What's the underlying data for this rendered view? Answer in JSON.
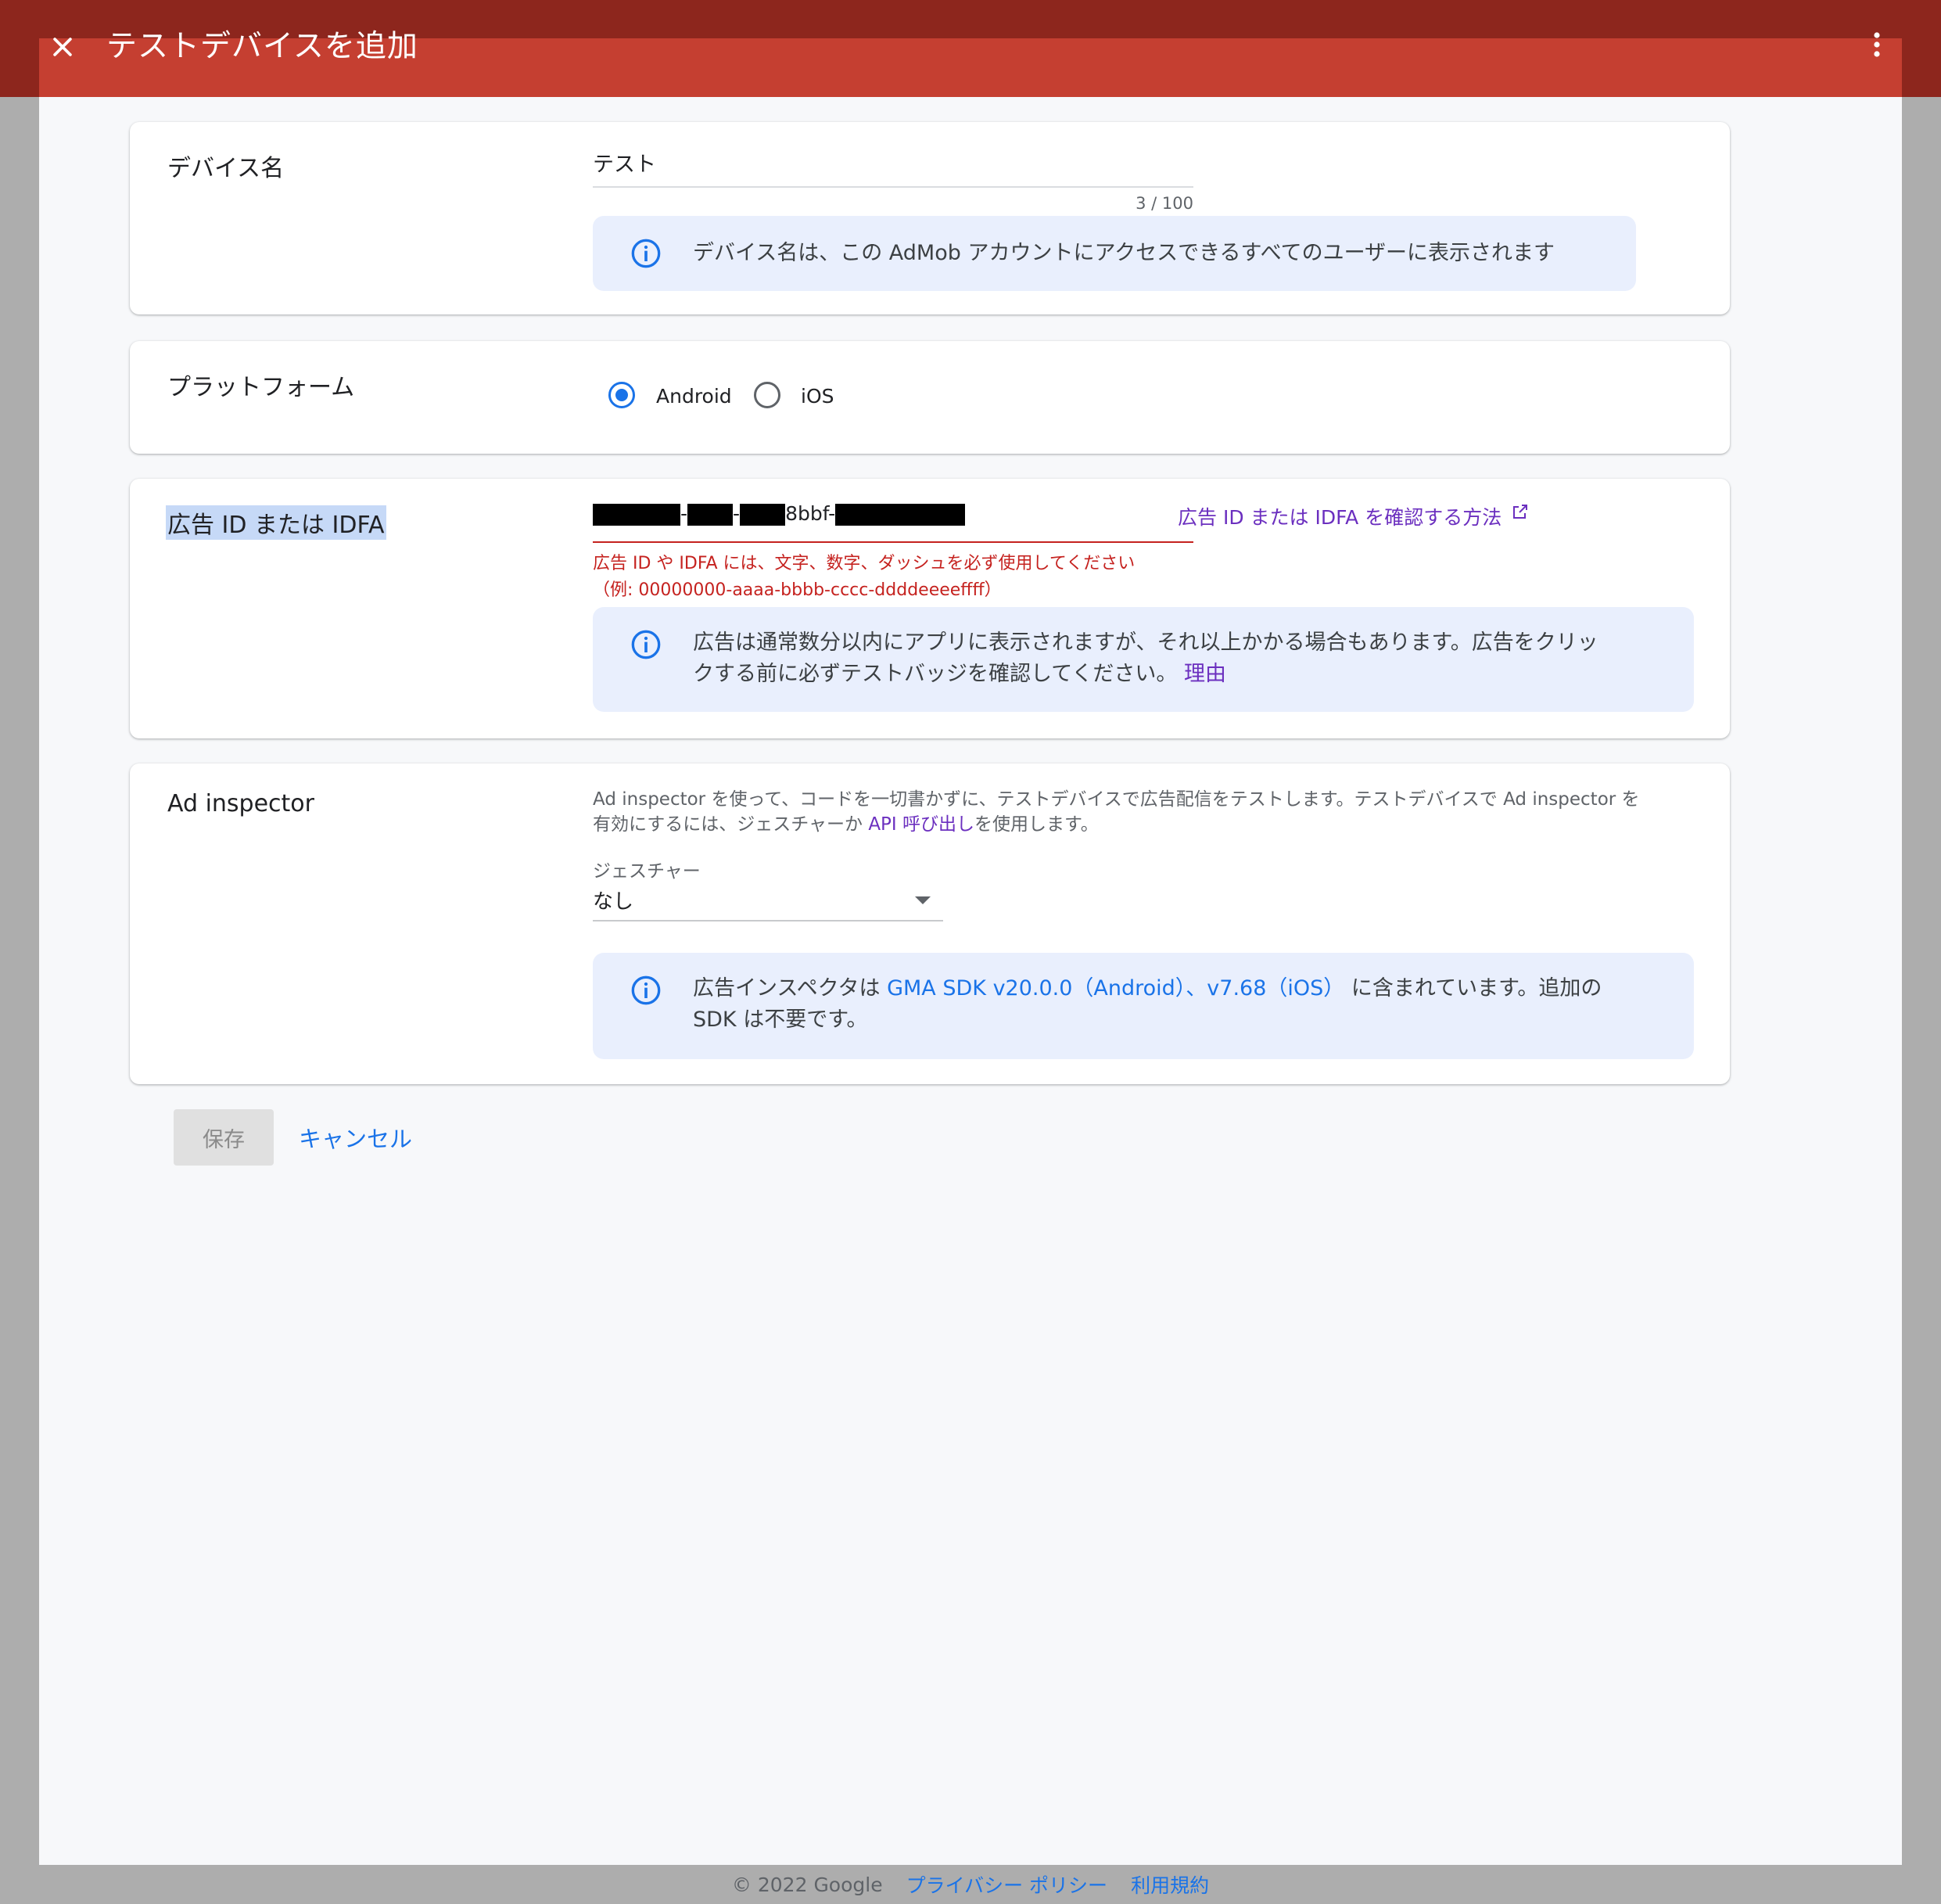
{
  "header": {
    "title": "テストデバイスを追加",
    "close_icon": "close-icon",
    "more_icon": "more-vert-icon"
  },
  "device_name": {
    "label": "デバイス名",
    "value": "テスト",
    "counter": "3 / 100",
    "info": "デバイス名は、この AdMob アカウントにアクセスできるすべてのユーザーに表示されます"
  },
  "platform": {
    "label": "プラットフォーム",
    "options": [
      "Android",
      "iOS"
    ],
    "selected": "Android"
  },
  "ad_id": {
    "label": "広告 ID または IDFA",
    "visible_value_part": "8bbf-",
    "help_link": "広告 ID または IDFA を確認する方法",
    "error_line1": "広告 ID や IDFA には、文字、数字、ダッシュを必ず使用してください",
    "error_line2": "（例: 00000000-aaaa-bbbb-cccc-ddddeeeeffff）",
    "info_line1": "広告は通常数分以内にアプリに表示されますが、それ以上かかる場合もあります。広告をクリッ",
    "info_line2": "クする前に必ずテストバッジを確認してください。",
    "info_link": "理由"
  },
  "ad_inspector": {
    "label": "Ad inspector",
    "desc_line1": "Ad inspector を使って、コードを一切書かずに、テストデバイスで広告配信をテストします。テストデバイスで Ad inspector を",
    "desc_line2_prefix": "有効にするには、ジェスチャーか ",
    "desc_link": "API 呼び出し",
    "desc_line2_suffix": "を使用します。",
    "gesture_label": "ジェスチャー",
    "gesture_value": "なし",
    "info_prefix": "広告インスペクタは ",
    "info_link": "GMA SDK v20.0.0（Android）、v7.68（iOS）",
    "info_suffix": " に含まれています。追加の",
    "info_line2": "SDK は不要です。"
  },
  "actions": {
    "save": "保存",
    "cancel": "キャンセル"
  },
  "footer": {
    "copyright": "© 2022 Google",
    "privacy": "プライバシー ポリシー",
    "terms": "利用規約"
  },
  "colors": {
    "header_red": "#c53f31",
    "header_dark": "#8d261d",
    "accent_blue": "#1a73e8",
    "error_red": "#c5221f",
    "info_bg": "#e9effd"
  }
}
